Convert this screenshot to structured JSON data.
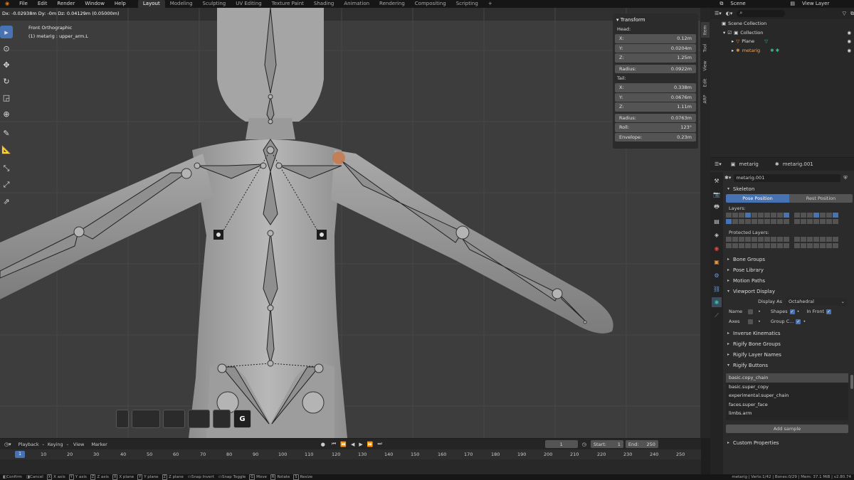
{
  "topbar": {
    "menus": [
      "File",
      "Edit",
      "Render",
      "Window",
      "Help"
    ],
    "workspaces": [
      "Layout",
      "Modeling",
      "Sculpting",
      "UV Editing",
      "Texture Paint",
      "Shading",
      "Animation",
      "Rendering",
      "Compositing",
      "Scripting"
    ],
    "add_tab": "+",
    "scene": "Scene",
    "view_layer": "View Layer"
  },
  "viewport": {
    "header_readout": "Dx: -0.02938m   Dy: -0m   Dz: 0.04129m (0.05000m)",
    "view_name": "Front Orthographic",
    "object_info": "(1) metarig : upper_arm.L",
    "g_key": "G"
  },
  "transform": {
    "title": "Transform",
    "head_label": "Head:",
    "head": [
      {
        "k": "X:",
        "v": "0.12m"
      },
      {
        "k": "Y:",
        "v": "0.0204m"
      },
      {
        "k": "Z:",
        "v": "1.25m"
      }
    ],
    "head_radius": {
      "k": "Radius:",
      "v": "0.0922m"
    },
    "tail_label": "Tail:",
    "tail": [
      {
        "k": "X:",
        "v": "0.338m"
      },
      {
        "k": "Y:",
        "v": "0.0676m"
      },
      {
        "k": "Z:",
        "v": "1.11m"
      }
    ],
    "tail_radius": {
      "k": "Radius:",
      "v": "0.0763m"
    },
    "roll": {
      "k": "Roll:",
      "v": "123°"
    },
    "envelope": {
      "k": "Envelope:",
      "v": "0.23m"
    }
  },
  "side_tabs": [
    "Item",
    "Tool",
    "View",
    "Edit",
    "ARP"
  ],
  "outliner": {
    "items": [
      "Scene Collection",
      "Collection",
      "Plane",
      "metarig"
    ]
  },
  "props": {
    "breadcrumb_object": "metarig",
    "breadcrumb_data": "metarig.001",
    "data_name": "metarig.001",
    "skeleton": "Skeleton",
    "pose_position": "Pose Position",
    "rest_position": "Rest Position",
    "layers": "Layers:",
    "protected_layers": "Protected Layers:",
    "sections_closed": [
      "Bone Groups",
      "Pose Library",
      "Motion Paths"
    ],
    "viewport_display": "Viewport Display",
    "display_as_label": "Display As",
    "display_as_value": "Octahedral",
    "name": "Name",
    "shapes": "Shapes",
    "in_front": "In Front",
    "axes": "Axes",
    "group_colors": "Group C...",
    "sections2": [
      "Inverse Kinematics",
      "Rigify Bone Groups",
      "Rigify Layer Names"
    ],
    "rigify_buttons": "Rigify Buttons",
    "rig_types": [
      "basic.copy_chain",
      "basic.super_copy",
      "experimental.super_chain",
      "faces.super_face",
      "limbs.arm"
    ],
    "add_sample": "Add sample",
    "custom_properties": "Custom Properties"
  },
  "timeline": {
    "menus": [
      "Playback",
      "Keying",
      "View",
      "Marker"
    ],
    "current_frame": "1",
    "start_label": "Start:",
    "start": "1",
    "end_label": "End:",
    "end": "250",
    "ticks": [
      "1",
      "10",
      "20",
      "30",
      "40",
      "50",
      "60",
      "70",
      "80",
      "90",
      "100",
      "110",
      "120",
      "130",
      "140",
      "150",
      "160",
      "170",
      "180",
      "190",
      "200",
      "210",
      "220",
      "230",
      "240",
      "250"
    ]
  },
  "statusbar": {
    "items": [
      {
        "key": "",
        "label": "Confirm"
      },
      {
        "key": "",
        "label": "Cancel"
      },
      {
        "key": "X",
        "label": "X axis"
      },
      {
        "key": "Y",
        "label": "Y axis"
      },
      {
        "key": "Z",
        "label": "Z axis"
      },
      {
        "key": "X",
        "label": "X plane"
      },
      {
        "key": "Y",
        "label": "Y plane"
      },
      {
        "key": "Z",
        "label": "Z plane"
      },
      {
        "key": "",
        "label": "Snap Invert"
      },
      {
        "key": "",
        "label": "Snap Toggle"
      },
      {
        "key": "G",
        "label": "Move"
      },
      {
        "key": "R",
        "label": "Rotate"
      },
      {
        "key": "S",
        "label": "Resize"
      }
    ],
    "stats": "metarig | Verts:1/42 | Bones:0/29 | Mem: 37.1 MiB | v2.80.74"
  },
  "colors": {
    "accent": "#4772b3",
    "selected_joint": "#c8794a",
    "viewport_bg": "#3d3d3d"
  }
}
